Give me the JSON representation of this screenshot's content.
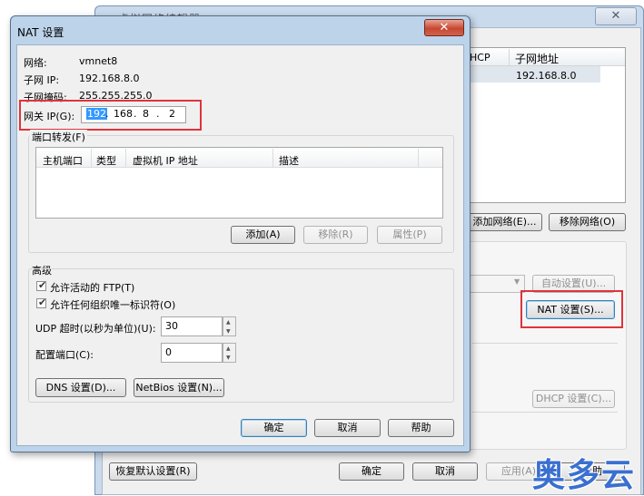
{
  "background_window": {
    "title": "虚拟网络编辑器",
    "close_glyph": "✕",
    "list_columns": [
      "HCP",
      "子网地址"
    ],
    "list_row_subnet": "192.168.8.0",
    "add_network": "添加网络(E)...",
    "remove_network": "移除网络(O)",
    "auto_settings": "自动设置(U)...",
    "nat_settings": "NAT 设置(S)...",
    "dhcp_settings": "DHCP 设置(C)...",
    "restore_defaults": "恢复默认设置(R)",
    "ok": "确定",
    "cancel": "取消",
    "apply": "应用(A)",
    "help": "帮助"
  },
  "nat_dialog": {
    "title": "NAT 设置",
    "close_glyph": "✕",
    "network_label": "网络:",
    "network_value": "vmnet8",
    "subnet_ip_label": "子网 IP:",
    "subnet_ip_value": "192.168.8.0",
    "subnet_mask_label": "子网掩码:",
    "subnet_mask_value": "255.255.255.0",
    "gateway_label": "网关 IP(G):",
    "gateway": [
      "192",
      "168",
      "8",
      "2"
    ],
    "port_forward_label": "端口转发(F)",
    "table_columns": [
      "主机端口",
      "类型",
      "虚拟机 IP 地址",
      "描述"
    ],
    "add": "添加(A)",
    "remove": "移除(R)",
    "properties": "属性(P)",
    "advanced_label": "高级",
    "allow_ftp": "允许活动的 FTP(T)",
    "allow_any_oui": "允许任何组织唯一标识符(O)",
    "udp_timeout_label": "UDP 超时(以秒为单位)(U):",
    "udp_timeout_value": "30",
    "config_port_label": "配置端口(C):",
    "config_port_value": "0",
    "dns_settings": "DNS 设置(D)...",
    "netbios_settings": "NetBios 设置(N)...",
    "ok": "确定",
    "cancel": "取消",
    "help": "帮助"
  },
  "watermark": "奥多云",
  "colors": {
    "highlight": "#e0333b",
    "selection": "#3399ff",
    "title_bar": "#bcd3ea"
  }
}
